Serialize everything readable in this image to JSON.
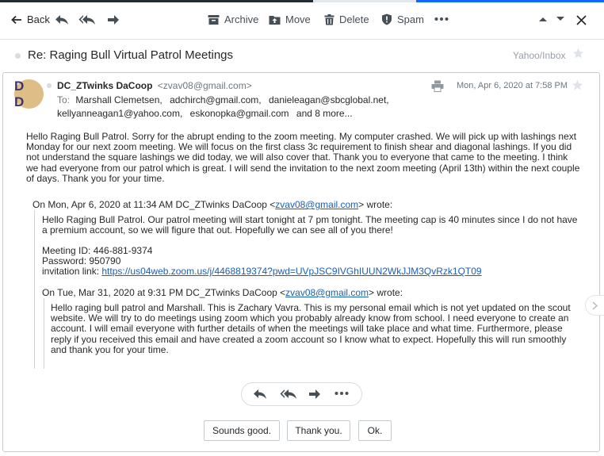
{
  "toolbar": {
    "back_label": "Back",
    "archive_label": "Archive",
    "move_label": "Move",
    "delete_label": "Delete",
    "spam_label": "Spam"
  },
  "message": {
    "subject": "Re: Raging Bull Virtual Patrol Meetings",
    "folder": "Yahoo/Inbox",
    "avatar_initials": "D D",
    "sender_name": "DC_ZTwinks DaCoop",
    "sender_email": "<zvav08@gmail.com>",
    "date": "Mon, Apr 6, 2020 at 7:58 PM",
    "to_label": "To:",
    "recipients_line1": [
      "Marshall Clemetsen,",
      "adchirch@gmail.com,",
      "danieleagan@sbcglobal.net,"
    ],
    "recipients_line2": [
      "kellyanneagan1@yahoo.com,",
      "eskonopka@gmail.com"
    ],
    "more_recipients": "and 8 more...",
    "body": "Hello Raging Bull Patrol. Sorry for the abrupt ending to the zoom meeting. My computer crashed. We will pick up with lashings next Monday for our next zoom meeting. We will focus on the first class 3c requirement to finish shear and diagonal lashings. If you did not understand the square lashings we did today, we will also cover that. Thank you to everyone that came to the meeting. I think we had everyone from our patrol which is great. I will send the invitation to the next zoom meeting (April 13th) within the next couple of days. Thank you for your time.",
    "quote1": {
      "intro_prefix": "On Mon, Apr 6, 2020 at 11:34 AM DC_ZTwinks DaCoop <",
      "intro_email": "zvav08@gmail.com",
      "intro_suffix": "> wrote:",
      "text": "Hello Raging Bull Patrol. Our patrol meeting will start tonight at 7 pm tonight. The meeting cap is 40 minutes since I do not have a premium account, so we will figure that out. Hopefully we can see all of you there!",
      "meeting_id": "Meeting ID:  446-881-9374",
      "password": "Password:  950790",
      "invitation_label": "invitation link: ",
      "invitation_link": "https://us04web.zoom.us/j/4468819374?pwd=UVpJSC9IVGhIUUN2WkJJM3QvRzk1QT09"
    },
    "quote2": {
      "intro_prefix": "On Tue, Mar 31, 2020 at 9:31 PM DC_ZTwinks DaCoop <",
      "intro_email": "zvav08@gmail.com",
      "intro_suffix": "> wrote:",
      "text": "Hello raging bull patrol and Marshall. This is Zachary Vavra. This is my personal email which is not yet updated on the scout website. We will try to do meetings using zoom which you probably already know from school. I need everyone to create an account. I will email everyone with further details of when the meetings will take place and what time. Furthermore, please reply if you received this email and have created a zoom account so I know what to expect. Hopefully this will run smoothly and thank you for your time."
    }
  },
  "quick_replies": [
    "Sounds good.",
    "Thank you.",
    "Ok."
  ],
  "colors": {
    "accent": "#0f69ff",
    "link": "#1a5fb4",
    "avatar_bg": "#dfbd86",
    "avatar_fg": "#3b3470"
  },
  "icons": [
    "back-arrow-icon",
    "reply-icon",
    "reply-all-icon",
    "forward-icon",
    "archive-icon",
    "move-icon",
    "trash-icon",
    "shield-icon",
    "more-icon",
    "chevron-up-icon",
    "chevron-down-icon",
    "close-icon",
    "star-icon",
    "print-icon",
    "chevron-right-icon"
  ]
}
